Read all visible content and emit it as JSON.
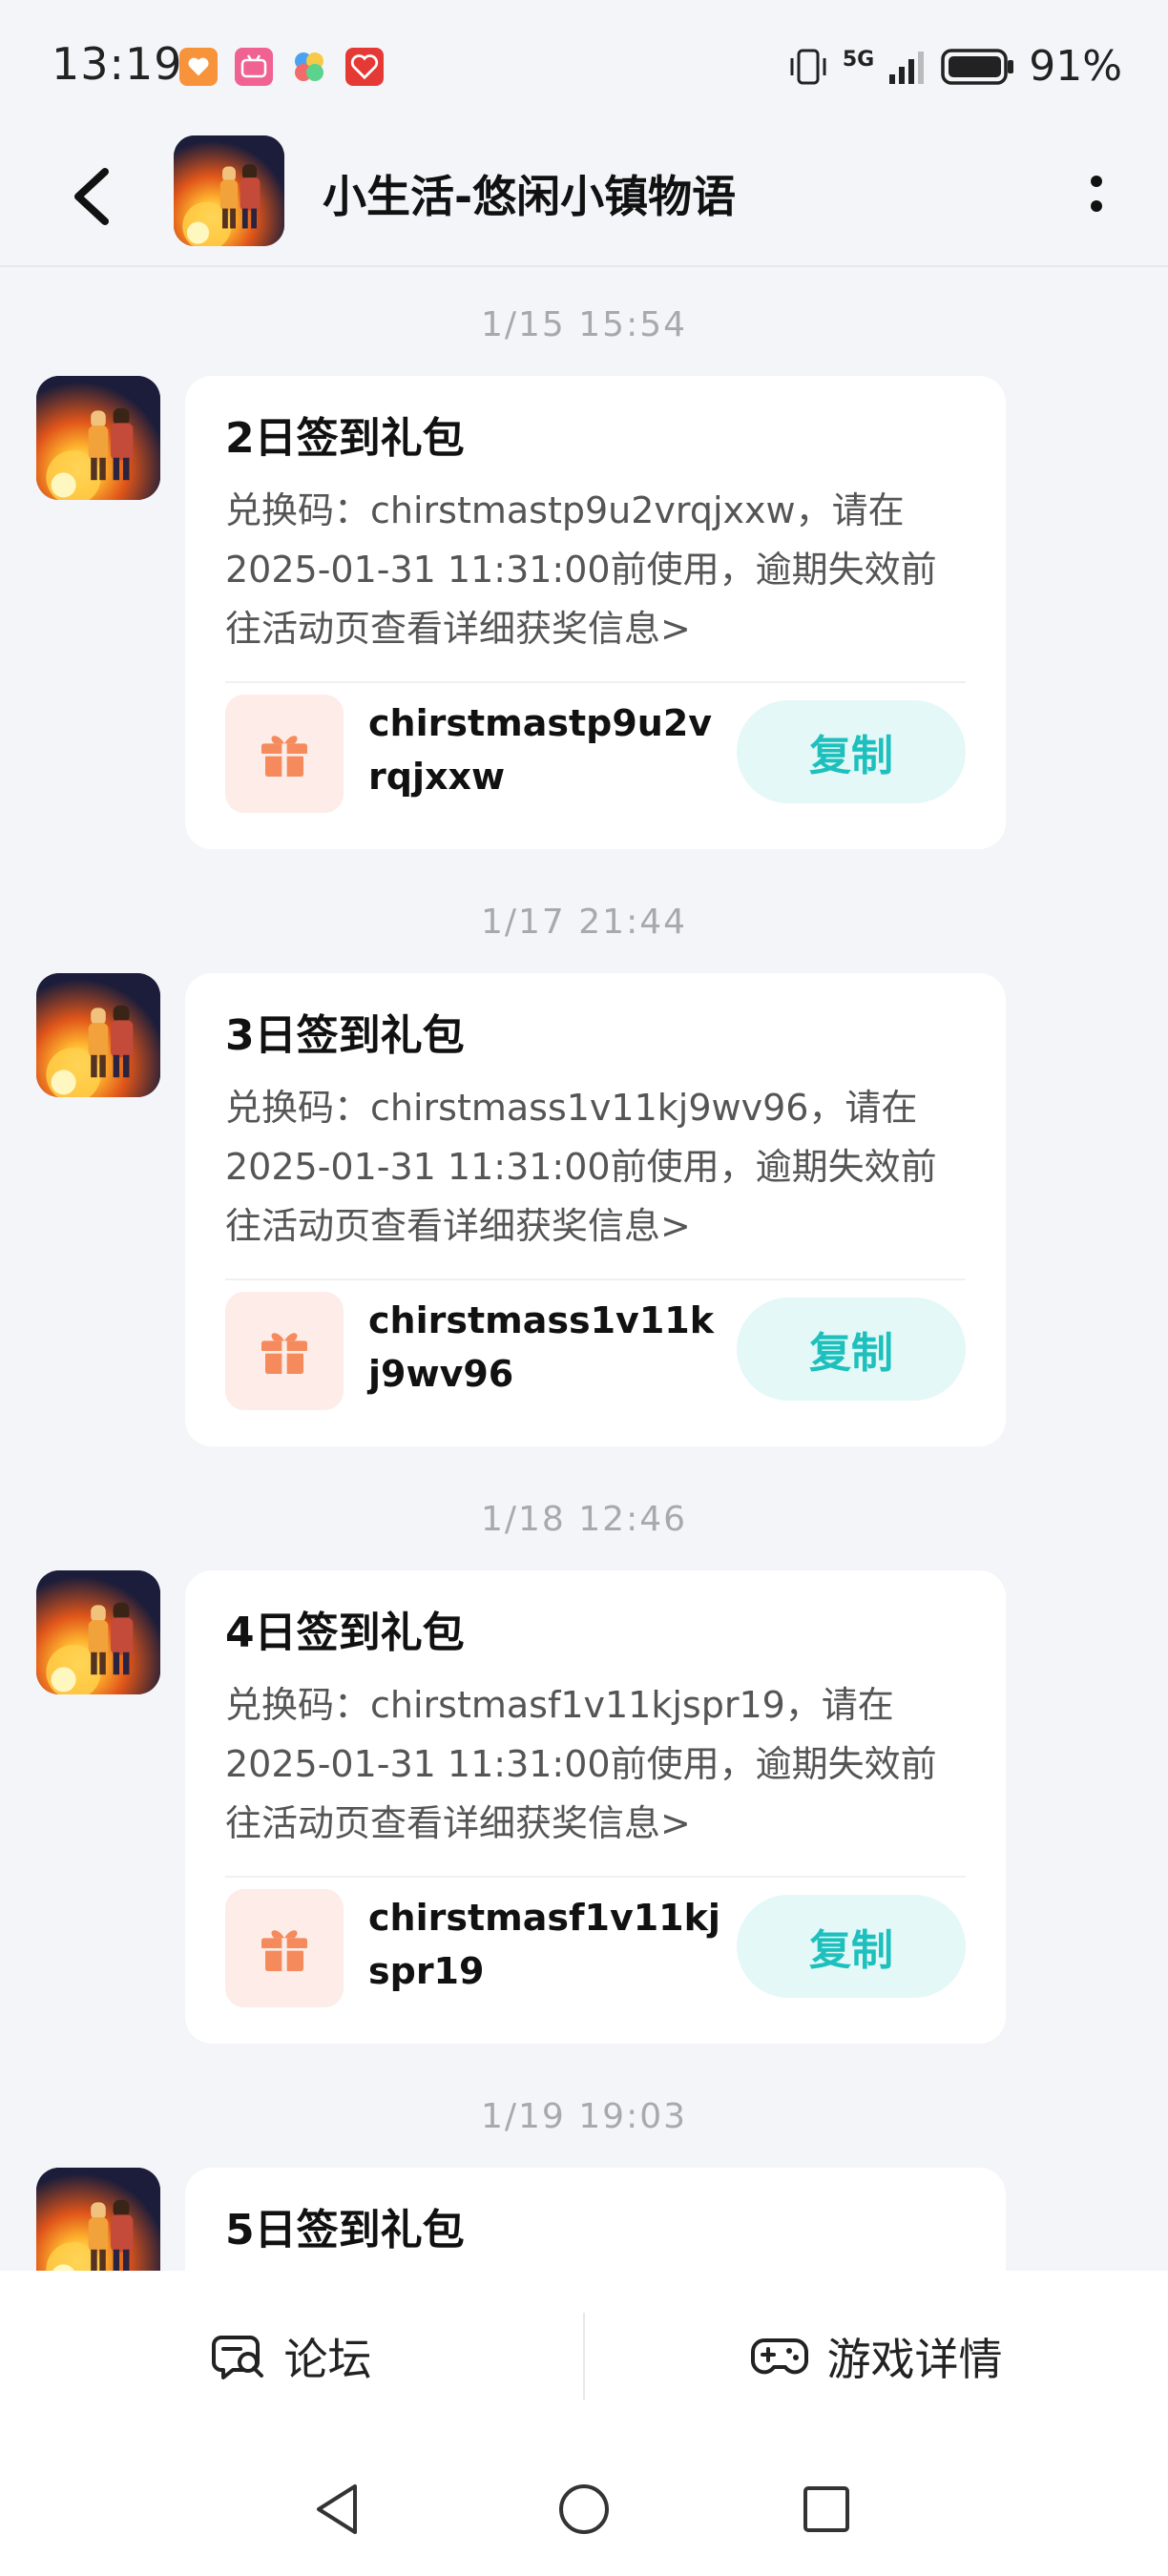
{
  "status_bar": {
    "time": "13:19",
    "battery": "91%",
    "network": "5G",
    "app_icons": [
      "orange-heart-app-icon",
      "bilibili-icon",
      "pinwheel-app-icon",
      "red-heart-app-icon"
    ]
  },
  "header": {
    "title": "小生活-悠闲小镇物语"
  },
  "messages": [
    {
      "time": "1/15  15:54",
      "title": "2日签到礼包",
      "desc": "兑换码：chirstmastp9u2vrqjxxw，请在2025-01-31 11:31:00前使用，逾期失效前往活动页查看详细获奖信息>",
      "code": "chirstmastp9u2vrqjxxw",
      "copy_label": "复制"
    },
    {
      "time": "1/17  21:44",
      "title": "3日签到礼包",
      "desc": "兑换码：chirstmass1v11kj9wv96，请在2025-01-31 11:31:00前使用，逾期失效前往活动页查看详细获奖信息>",
      "code": "chirstmass1v11kj9wv96",
      "copy_label": "复制"
    },
    {
      "time": "1/18  12:46",
      "title": "4日签到礼包",
      "desc": "兑换码：chirstmasf1v11kjspr19，请在2025-01-31 11:31:00前使用，逾期失效前往活动页查看详细获奖信息>",
      "code": "chirstmasf1v11kjspr19",
      "copy_label": "复制"
    },
    {
      "time": "1/19  19:03",
      "title": "5日签到礼包"
    }
  ],
  "bottom_bar": {
    "forum_label": "论坛",
    "game_detail_label": "游戏详情"
  },
  "colors": {
    "accent": "#1dc0bd",
    "copy_bg": "#e4f8f7",
    "gift_orange": "#f58a5c",
    "page_bg": "#f4f5f8"
  }
}
